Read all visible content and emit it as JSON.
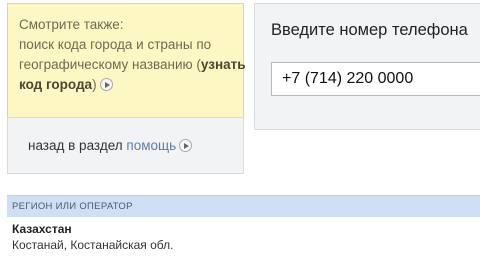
{
  "see_also": {
    "line1": "Смотрите также:",
    "line2": "поиск кода города и страны по",
    "line3_prefix": "географическому названию (",
    "link_part1": "узнать",
    "link_part2": "код города",
    "line4_suffix": ")"
  },
  "back": {
    "text": "назад в раздел ",
    "link": "помощь"
  },
  "phone": {
    "title": "Введите номер телефона",
    "value": "+7 (714) 220 0000"
  },
  "result": {
    "header": "РЕГИОН ИЛИ ОПЕРАТОР",
    "country": "Казахстан",
    "city": "Костанай, Костанайская обл."
  }
}
